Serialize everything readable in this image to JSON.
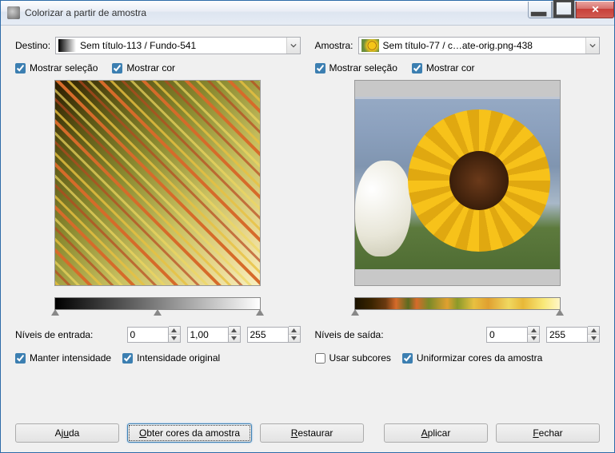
{
  "window": {
    "title": "Colorizar a partir de amostra"
  },
  "dest": {
    "label": "Destino:",
    "combo": "Sem título-113 / Fundo-541",
    "show_selection": "Mostrar seleção",
    "show_color": "Mostrar cor",
    "levels_label": "Níveis de entrada:",
    "lvl_lo": "0",
    "lvl_gamma": "1,00",
    "lvl_hi": "255",
    "keep_intensity": "Manter intensidade",
    "orig_intensity": "Intensidade original"
  },
  "sample": {
    "label": "Amostra:",
    "combo": "Sem título-77 / c…ate-orig.png-438",
    "show_selection": "Mostrar seleção",
    "show_color": "Mostrar cor",
    "levels_label": "Níveis de saída:",
    "lvl_lo": "0",
    "lvl_hi": "255",
    "use_subcolors": "Usar subcores",
    "smooth": "Uniformizar cores da amostra"
  },
  "buttons": {
    "help": "Aj_uda",
    "get": "_Obter cores da amostra",
    "reset": "_Restaurar",
    "apply": "_Aplicar",
    "close": "_Fechar"
  }
}
